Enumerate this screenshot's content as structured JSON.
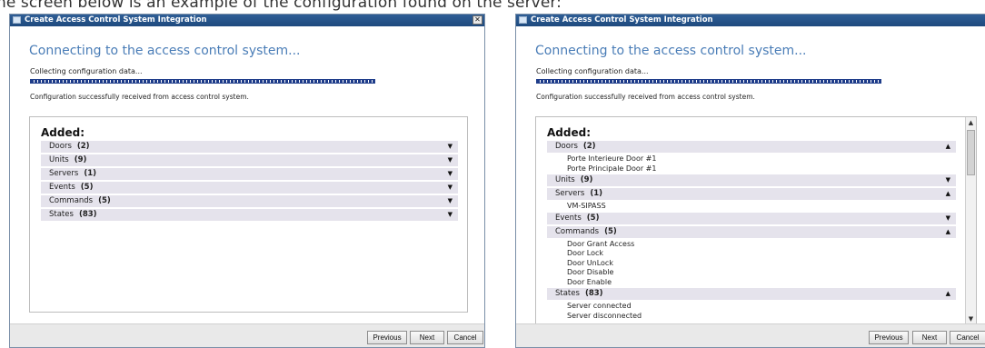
{
  "caption": "he screen below is an example of the configuration found on the server:",
  "window_title": "Create Access Control System Integration",
  "close_glyph": "✕",
  "heading": "Connecting to the access control system...",
  "collecting_text": "Collecting configuration data...",
  "progress_complete": 1.0,
  "success_text": "Configuration successfully received from access control system.",
  "added_label": "Added:",
  "buttons": {
    "previous": "Previous",
    "next": "Next",
    "cancel": "Cancel"
  },
  "icons": {
    "collapsed": "chevron-down-icon",
    "expanded": "chevron-up-icon"
  },
  "colors": {
    "accent": "#4a7db7",
    "titlebar": "#2f5e96",
    "section_row": "#e5e3ec",
    "progress": "#1f3d8a"
  },
  "left_dialog": {
    "sections": [
      {
        "name": "Doors",
        "count": "(2)"
      },
      {
        "name": "Units",
        "count": "(9)"
      },
      {
        "name": "Servers",
        "count": "(1)"
      },
      {
        "name": "Events",
        "count": "(5)"
      },
      {
        "name": "Commands",
        "count": "(5)"
      },
      {
        "name": "States",
        "count": "(83)"
      }
    ]
  },
  "right_dialog": {
    "doors": {
      "name": "Doors",
      "count": "(2)",
      "items": [
        "Porte Interieure Door #1",
        "Porte Principale Door #1"
      ]
    },
    "units": {
      "name": "Units",
      "count": "(9)"
    },
    "servers": {
      "name": "Servers",
      "count": "(1)",
      "items": [
        "VM-SIPASS"
      ]
    },
    "events": {
      "name": "Events",
      "count": "(5)"
    },
    "commands": {
      "name": "Commands",
      "count": "(5)",
      "items": [
        "Door Grant Access",
        "Door Lock",
        "Door UnLock",
        "Door Disable",
        "Door Enable"
      ]
    },
    "states": {
      "name": "States",
      "count": "(83)",
      "items": [
        "Server connected",
        "Server disconnected"
      ]
    }
  }
}
